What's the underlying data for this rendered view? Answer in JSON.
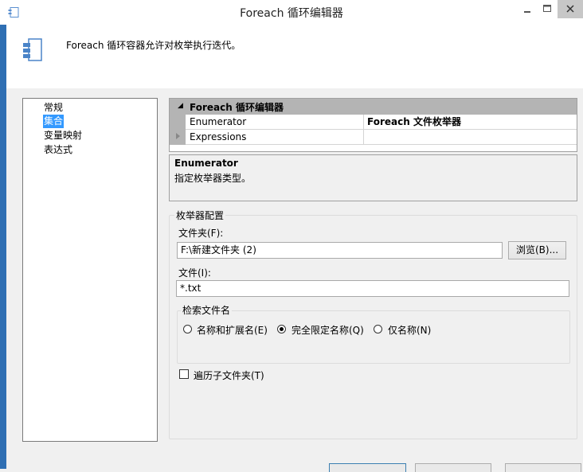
{
  "window": {
    "title": "Foreach 循环编辑器"
  },
  "header": {
    "description": "Foreach 循环容器允许对枚举执行迭代。"
  },
  "nav": {
    "items": [
      "常规",
      "集合",
      "变量映射",
      "表达式"
    ],
    "selected": "集合"
  },
  "property_grid": {
    "category": "Foreach 循环编辑器",
    "rows": [
      {
        "name": "Enumerator",
        "value": "Foreach 文件枚举器"
      },
      {
        "name": "Expressions",
        "value": ""
      }
    ]
  },
  "description_panel": {
    "title": "Enumerator",
    "text": "指定枚举器类型。"
  },
  "enumerator_config": {
    "group_label": "枚举器配置",
    "folder_label": "文件夹(F):",
    "folder_value": "F:\\新建文件夹 (2)",
    "browse_label": "浏览(B)...",
    "files_label": "文件(I):",
    "files_value": "*.txt",
    "retrieve_group_label": "检索文件名",
    "radio_options": [
      {
        "label": "名称和扩展名(E)",
        "checked": false
      },
      {
        "label": "完全限定名称(Q)",
        "checked": true
      },
      {
        "label": "仅名称(N)",
        "checked": false
      }
    ],
    "traverse_label": "遍历子文件夹(T)",
    "traverse_checked": false
  },
  "colors": {
    "frame": "#2f6fb3",
    "selection": "#3399ff",
    "close_button": "#c7c7c7"
  }
}
